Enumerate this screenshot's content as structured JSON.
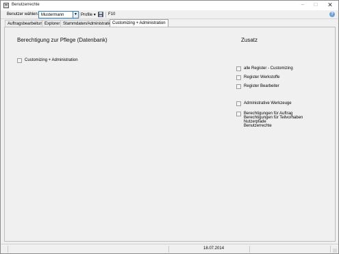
{
  "window": {
    "title": "Benutzerrechte",
    "minimize": "–",
    "maximize": "□",
    "close": "✕"
  },
  "toolbar": {
    "user_label": "Benutzer wählen:",
    "user_value": "Mustermann",
    "profile_label": "Profile",
    "profile_arrow": "▾",
    "f10_label": "F10",
    "help": "?"
  },
  "tabs": [
    {
      "label": "Auftragsbearbeitung",
      "active": false
    },
    {
      "label": "Explorer",
      "active": false
    },
    {
      "label": "Stammdaten/Administration",
      "active": false
    },
    {
      "label": "Customizing + Administration",
      "active": true
    }
  ],
  "main": {
    "left_heading": "Berechtigung zur Pflege (Datenbank)",
    "right_heading": "Zusatz",
    "left_checkboxes": [
      {
        "label": "Customizing + Administration",
        "checked": false
      }
    ],
    "right_checkboxes": [
      {
        "label": "alle Register - Customizing",
        "checked": false
      },
      {
        "label": "Register Werkstoffe",
        "checked": false
      },
      {
        "label": "Register Bearbeiter",
        "checked": false
      },
      {
        "label": "Administrative Werkzeuge",
        "checked": false
      }
    ],
    "multi_checkbox": {
      "checked": false,
      "lines": [
        "Berechtigungen für Auftrag",
        "Berechtigungen für Teilvorhaben",
        "Nutzerpfade",
        "Benutzerrechte"
      ]
    }
  },
  "status": {
    "date": "18.07.2014"
  }
}
